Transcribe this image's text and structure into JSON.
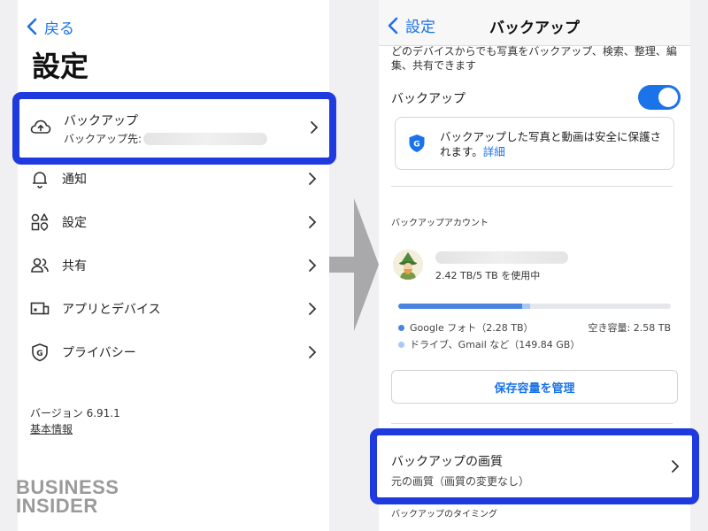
{
  "left": {
    "back_label": "戻る",
    "title": "設定",
    "backup_item": {
      "label": "バックアップ",
      "destination_prefix": "バックアップ先:"
    },
    "menu_items": [
      {
        "label": "通知",
        "icon": "bell-icon"
      },
      {
        "label": "設定",
        "icon": "shapes-icon"
      },
      {
        "label": "共有",
        "icon": "people-icon"
      },
      {
        "label": "アプリとデバイス",
        "icon": "devices-icon"
      },
      {
        "label": "プライバシー",
        "icon": "privacy-shield-icon"
      }
    ],
    "version": "バージョン 6.91.1",
    "about_link": "基本情報"
  },
  "watermark": {
    "line1": "BUSINESS",
    "line2": "INSIDER"
  },
  "right": {
    "back_label": "設定",
    "title": "バックアップ",
    "intro": "どのデバイスからでも写真をバックアップ、検索、整理、編集、共有できます",
    "backup_toggle": {
      "label": "バックアップ",
      "on": true
    },
    "safety_card": {
      "text": "バックアップした写真と動画は安全に保護されます。",
      "link": "詳細"
    },
    "account_section_label": "バックアップアカウント",
    "usage": "2.42 TB/5 TB を使用中",
    "storage": {
      "photos_fraction": 0.456,
      "drive_fraction": 0.03,
      "photos_label": "Google フォト（2.28 TB）",
      "drive_label": "ドライブ、Gmail など（149.84 GB）",
      "free_label": "空き容量: 2.58 TB"
    },
    "manage_button": "保存容量を管理",
    "quality": {
      "title": "バックアップの画質",
      "subtitle": "元の画質（画質の変更なし）"
    },
    "timing_section_label": "バックアップのタイミング"
  },
  "colors": {
    "accent": "#1a73e8",
    "highlight": "#1f3be0",
    "photos_bar": "#4b84e0",
    "drive_bar": "#a9c8f4"
  }
}
